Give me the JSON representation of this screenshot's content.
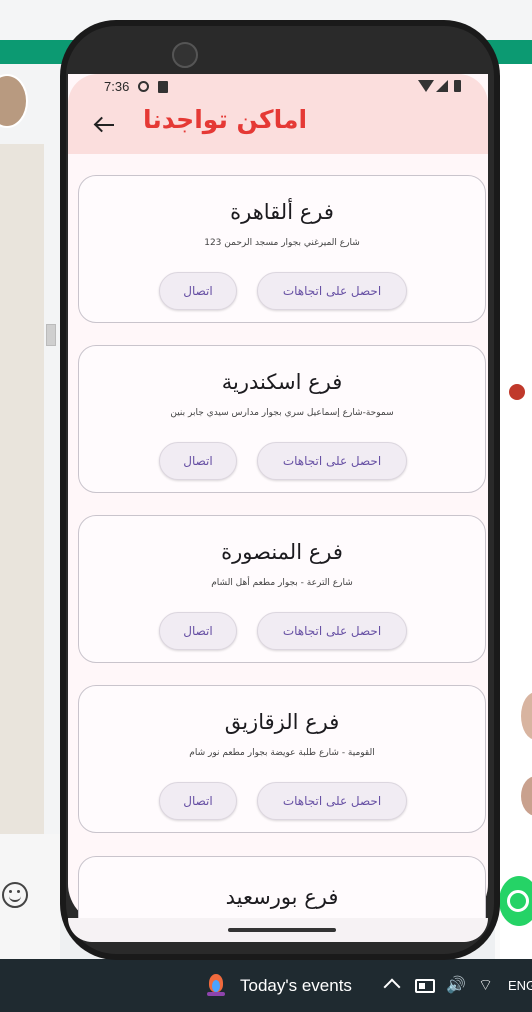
{
  "app": {
    "title": "اماكن تواجدنا",
    "accent_color": "#e53935",
    "header_color": "#fbdedd"
  },
  "status_bar": {
    "time": "7:36",
    "icons": [
      "settings-icon",
      "sim-icon",
      "wifi-icon",
      "signal-icon",
      "battery-icon"
    ]
  },
  "branches": [
    {
      "name": "فرع ألقاهرة",
      "address": "شارع الميرغني بجوار مسجد الرحمن 123",
      "directions_label": "احصل على اتجاهات",
      "call_label": "اتصال"
    },
    {
      "name": "فرع اسكندرية",
      "address": "سموحة-شارع إسماعيل سري بجوار مدارس سيدي جابر بنين",
      "directions_label": "احصل على اتجاهات",
      "call_label": "اتصال"
    },
    {
      "name": "فرع المنصورة",
      "address": "شارع الترعة - بجوار مطعم أهل الشام",
      "directions_label": "احصل على اتجاهات",
      "call_label": "اتصال"
    },
    {
      "name": "فرع الزقازيق",
      "address": "القومية - شارع طلبة عويضة بجوار مطعم نور شام",
      "directions_label": "احصل على اتجاهات",
      "call_label": "اتصال"
    },
    {
      "name": "فرع بورسعيد"
    }
  ],
  "taskbar": {
    "weather_label": "Today's events",
    "language": "ENG"
  }
}
